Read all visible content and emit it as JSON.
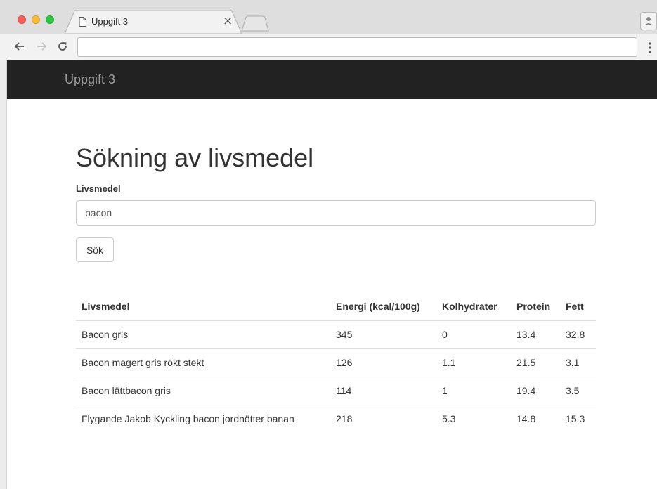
{
  "browser": {
    "tab_title": "Uppgift 3",
    "tab_close": "×",
    "address": ""
  },
  "navbar": {
    "brand": "Uppgift 3"
  },
  "main": {
    "title": "Sökning av livsmedel",
    "field_label": "Livsmedel",
    "search_value": "bacon",
    "search_button": "Sök"
  },
  "table": {
    "headers": [
      "Livsmedel",
      "Energi (kcal/100g)",
      "Kolhydrater",
      "Protein",
      "Fett"
    ],
    "rows": [
      [
        "Bacon gris",
        "345",
        "0",
        "13.4",
        "32.8"
      ],
      [
        "Bacon magert gris rökt stekt",
        "126",
        "1.1",
        "21.5",
        "3.1"
      ],
      [
        "Bacon lättbacon gris",
        "114",
        "1",
        "19.4",
        "3.5"
      ],
      [
        "Flygande Jakob Kyckling bacon jordnötter banan",
        "218",
        "5.3",
        "14.8",
        "15.3"
      ]
    ]
  },
  "colors": {
    "navbar_bg": "#222222",
    "brand_text": "#9d9d9d",
    "text": "#333333"
  }
}
